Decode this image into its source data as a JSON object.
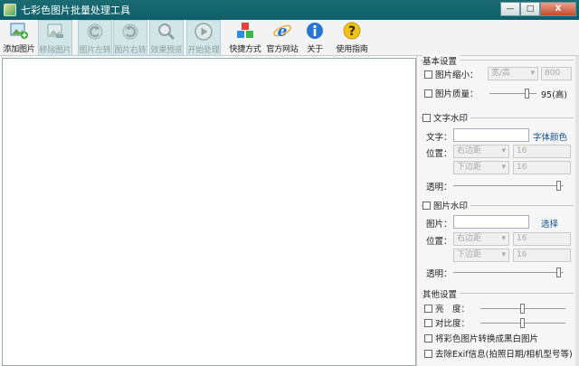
{
  "window": {
    "title": "七彩色图片批量处理工具",
    "controls": {
      "minimize": "—",
      "maximize": "□",
      "close": "X"
    }
  },
  "toolbar": {
    "add_image": "添加图片",
    "remove_image": "移除图片",
    "rotate_left": "图片左转",
    "rotate_right": "图片右转",
    "preview": "效果预览",
    "start": "开始处理",
    "shortcuts": "快捷方式",
    "website": "官方网站",
    "about": "关于",
    "help": "使用指南"
  },
  "panel": {
    "basic": {
      "title": "基本设置",
      "resize_label": "图片缩小：",
      "resize_mode": "宽/高",
      "resize_value": "800",
      "quality_label": "图片质量：",
      "quality_value": "95(高)",
      "quality_level": 0.85
    },
    "text_watermark": {
      "title": "文字水印",
      "text_label": "文字：",
      "text_value": "",
      "font_color_button": "字体颜色",
      "position_label": "位置：",
      "h_align": "右边距",
      "h_offset": "16",
      "v_align": "下边距",
      "v_offset": "16",
      "opacity_label": "透明：",
      "opacity_level": 0.98
    },
    "image_watermark": {
      "title": "图片水印",
      "image_label": "图片：",
      "image_value": "",
      "choose_button": "选择",
      "position_label": "位置：",
      "h_align": "右边距",
      "h_offset": "16",
      "v_align": "下边距",
      "v_offset": "16",
      "opacity_label": "透明：",
      "opacity_level": 0.98
    },
    "other": {
      "title": "其他设置",
      "brightness_label": "亮　度：",
      "brightness_level": 0.5,
      "contrast_label": "对比度：",
      "contrast_level": 0.5,
      "grayscale_label": "将彩色图片转换成黑白图片",
      "remove_exif_label": "去除Exif信息(拍照日期/相机型号等)"
    }
  }
}
